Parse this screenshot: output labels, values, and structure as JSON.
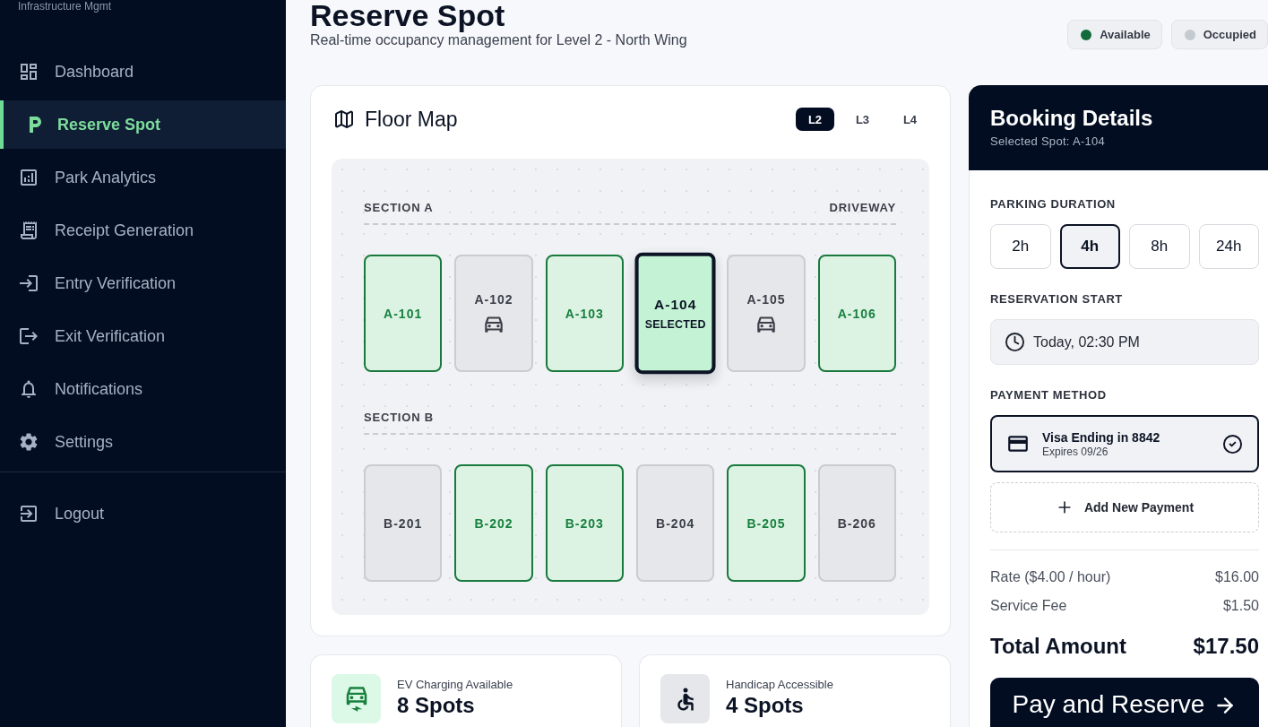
{
  "sidebar": {
    "subtitle": "Infrastructure Mgmt",
    "items": [
      {
        "label": "Dashboard",
        "selected": false
      },
      {
        "label": "Reserve Spot",
        "selected": true
      },
      {
        "label": "Park Analytics",
        "selected": false
      },
      {
        "label": "Receipt Generation",
        "selected": false
      },
      {
        "label": "Entry Verification",
        "selected": false
      },
      {
        "label": "Exit Verification",
        "selected": false
      },
      {
        "label": "Notifications",
        "selected": false
      },
      {
        "label": "Settings",
        "selected": false
      }
    ],
    "footer_items": [
      {
        "label": "Logout",
        "selected": false
      }
    ]
  },
  "header": {
    "title": "Reserve Spot",
    "subtitle": "Real-time occupancy management for Level 2 - North Wing",
    "legend": [
      {
        "label": "Available",
        "color": "#116b3a"
      },
      {
        "label": "Occupied",
        "color": "#c5c9d0"
      }
    ]
  },
  "floor_map": {
    "title": "Floor Map",
    "levels": [
      {
        "label": "L2",
        "selected": true
      },
      {
        "label": "L3",
        "selected": false
      },
      {
        "label": "L4",
        "selected": false
      }
    ],
    "sections": [
      {
        "label": "SECTION A",
        "side_label": "DRIVEWAY",
        "spots": [
          {
            "id": "A-101",
            "occupied": false,
            "vehicle": false,
            "selected": false
          },
          {
            "id": "A-102",
            "occupied": true,
            "vehicle": true,
            "selected": false
          },
          {
            "id": "A-103",
            "occupied": false,
            "vehicle": false,
            "selected": false
          },
          {
            "id": "A-104",
            "occupied": false,
            "vehicle": false,
            "selected": true,
            "badge": "SELECTED"
          },
          {
            "id": "A-105",
            "occupied": true,
            "vehicle": true,
            "selected": false
          },
          {
            "id": "A-106",
            "occupied": false,
            "vehicle": false,
            "selected": false
          }
        ]
      },
      {
        "label": "SECTION B",
        "spots": [
          {
            "id": "B-201",
            "occupied": true,
            "vehicle": false,
            "selected": false
          },
          {
            "id": "B-202",
            "occupied": false,
            "vehicle": false,
            "selected": false
          },
          {
            "id": "B-203",
            "occupied": false,
            "vehicle": false,
            "selected": false
          },
          {
            "id": "B-204",
            "occupied": true,
            "vehicle": false,
            "selected": false
          },
          {
            "id": "B-205",
            "occupied": false,
            "vehicle": false,
            "selected": false
          },
          {
            "id": "B-206",
            "occupied": true,
            "vehicle": false,
            "selected": false
          }
        ]
      }
    ]
  },
  "features": [
    {
      "kind": "ev",
      "label": "EV Charging Available",
      "value": "8 Spots"
    },
    {
      "kind": "accessible",
      "label": "Handicap Accessible",
      "value": "4 Spots"
    }
  ],
  "booking": {
    "title": "Booking Details",
    "subtitle": "Selected Spot: A-104",
    "duration": {
      "label": "PARKING DURATION",
      "options": [
        {
          "label": "2h",
          "selected": false
        },
        {
          "label": "4h",
          "selected": true
        },
        {
          "label": "8h",
          "selected": false
        },
        {
          "label": "24h",
          "selected": false
        }
      ]
    },
    "start": {
      "label": "RESERVATION START",
      "value": "Today, 02:30 PM"
    },
    "payment": {
      "label": "PAYMENT METHOD",
      "methods": [
        {
          "title": "Visa Ending in 8842",
          "detail": "Expires 09/26",
          "selected": true
        }
      ],
      "add_label": "Add New Payment"
    },
    "lines": [
      {
        "label": "Rate ($4.00 / hour)",
        "amount": "$16.00"
      },
      {
        "label": "Service Fee",
        "amount": "$1.50"
      }
    ],
    "total": {
      "label": "Total Amount",
      "amount": "$17.50"
    },
    "action": "Pay and Reserve"
  }
}
